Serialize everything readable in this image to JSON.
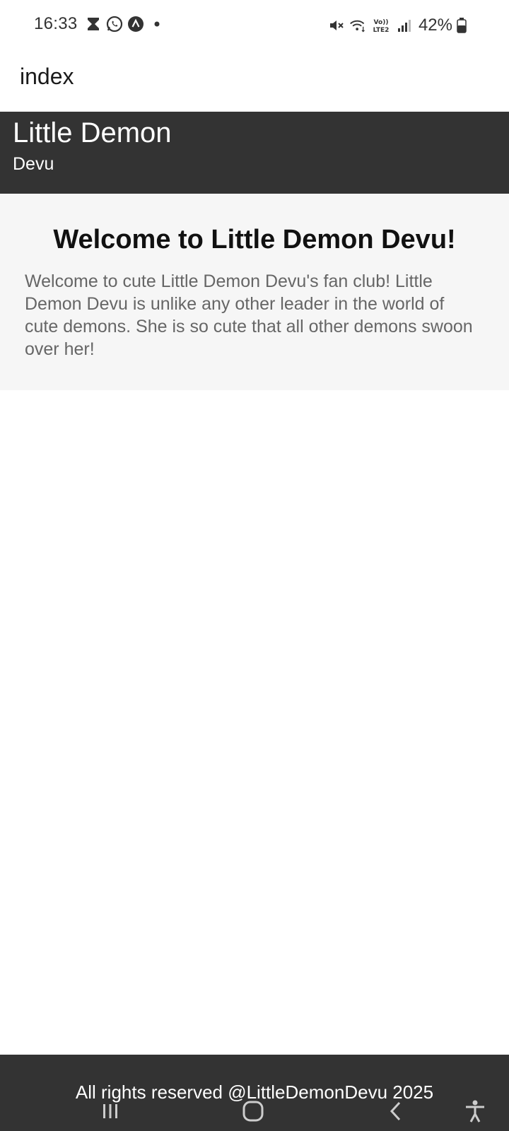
{
  "status_bar": {
    "time": "16:33",
    "battery": "42%",
    "left_icons": [
      "hourglass-icon",
      "whatsapp-icon",
      "app-notification-icon",
      "dot-icon"
    ],
    "right_icons": [
      "mute-icon",
      "wifi-icon",
      "volte-lte2-icon",
      "signal-icon",
      "battery-icon"
    ]
  },
  "app_bar": {
    "title": "index"
  },
  "header": {
    "title": "Little Demon",
    "subtitle": "Devu",
    "bg_color": "#333333"
  },
  "content": {
    "heading": "Welcome to Little Demon Devu!",
    "body": "Welcome to cute Little Demon Devu's fan club! Little Demon Devu is unlike any other leader in the world of cute demons. She is so cute that all other demons swoon over her!",
    "bg_color": "#f6f6f6"
  },
  "footer": {
    "text": "All rights reserved @LittleDemonDevu 2025",
    "bg_color": "#333333"
  },
  "nav_bar": {
    "icons": [
      "recent-apps-icon",
      "home-icon",
      "back-icon",
      "accessibility-icon"
    ]
  }
}
